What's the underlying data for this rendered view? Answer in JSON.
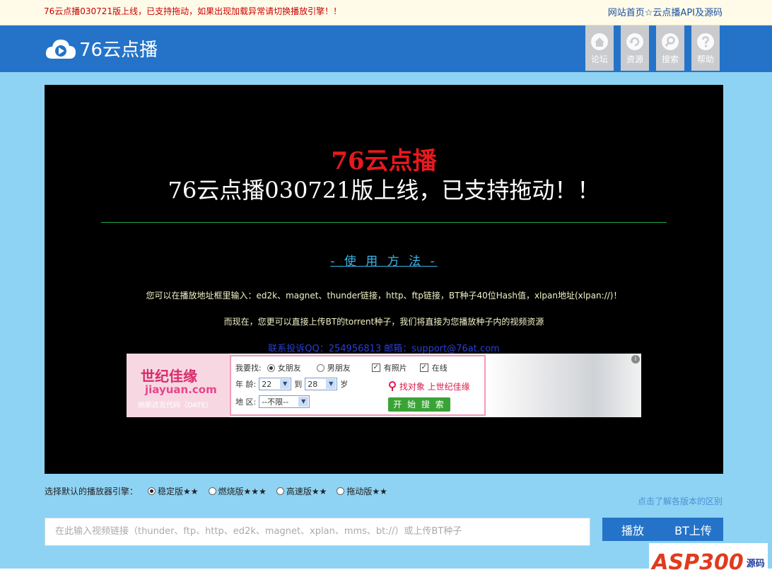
{
  "topbar": {
    "notice": "76云点播030721版上线，已支持拖动，如果出现加载异常请切换播放引擎！！",
    "link_home": "网站首页",
    "separator": "☆",
    "link_api": "云点播API及源码"
  },
  "header": {
    "logo_text": "76云点播",
    "nav": [
      {
        "label": "论坛",
        "icon": "home-icon"
      },
      {
        "label": "资源",
        "icon": "refresh-icon"
      },
      {
        "label": "搜索",
        "icon": "search-icon"
      },
      {
        "label": "帮助",
        "icon": "help-icon"
      }
    ]
  },
  "player": {
    "title": "76云点播",
    "subtitle": "76云点播030721版上线，已支持拖动！！",
    "method_link": "- 使 用 方 法 -",
    "text1": "您可以在播放地址框里输入：ed2k、magnet、thunder链接，http、ftp链接，BT种子40位Hash值，xlpan地址(xlpan://)！",
    "text2": "而现在，您更可以直接上传BT的torrent种子，我们将直接为您播放种子内的视频资源",
    "contact": "联系投诉QQ：254956813 邮箱：support@76at.com"
  },
  "ad": {
    "brand_cn": "世纪佳缘",
    "brand_en": "jiayuan.com",
    "tagline": "纳斯达克代码（DATE）",
    "find_label": "我要找:",
    "opt_female": "女朋友",
    "opt_male": "男朋友",
    "has_photo": "有照片",
    "online": "在线",
    "age_label": "年  龄:",
    "age_from": "22",
    "age_to_word": "到",
    "age_to": "28",
    "age_unit": "岁",
    "region_label": "地  区:",
    "region_value": "--不限--",
    "find_link": "找对象 上世纪佳缘",
    "search_button": "开 始 搜 索",
    "info_mark": "i"
  },
  "engine": {
    "label": "选择默认的播放器引擎：",
    "options": [
      {
        "label": "稳定版★★",
        "selected": true
      },
      {
        "label": "燃烧版★★★",
        "selected": false
      },
      {
        "label": "高速版★★",
        "selected": false
      },
      {
        "label": "拖动版★★",
        "selected": false
      }
    ],
    "diff_link": "点击了解各版本的区别"
  },
  "url_input": {
    "placeholder": "在此输入视频链接（thunder、ftp、http、ed2k、magnet、xplan、mms、bt://）或上传BT种子"
  },
  "buttons": {
    "play": "播放",
    "bt_upload": "BT上传"
  },
  "watermark": {
    "main": "ASP300",
    "sub": "源码"
  },
  "colors": {
    "header_blue": "#2473c8",
    "page_bg": "#8ed3f4",
    "title_red": "#e8181e",
    "contact_blue": "#2a3fd4"
  }
}
